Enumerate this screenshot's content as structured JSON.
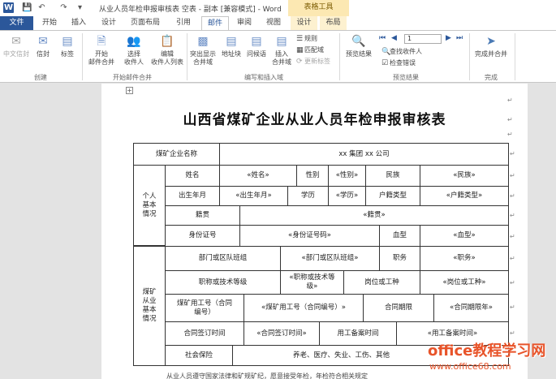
{
  "titlebar": {
    "title": "从业人员年检申报审核表 空表 - 副本 [兼容模式] - Word",
    "context_group": "表格工具",
    "app_icon": "W"
  },
  "tabs": {
    "file": "文件",
    "home": "开始",
    "insert": "插入",
    "design": "设计",
    "layout_page": "页面布局",
    "references": "引用",
    "mailings": "邮件",
    "review": "审阅",
    "view": "视图",
    "table_design": "设计",
    "table_layout": "布局"
  },
  "ribbon": {
    "create": {
      "chinese_envelope": "中文信封",
      "envelope": "信封",
      "labels": "标签",
      "group": "创建"
    },
    "start_merge": {
      "start": "开始",
      "start2": "邮件合并",
      "select": "选择",
      "select2": "收件人",
      "edit": "编辑",
      "edit2": "收件人列表",
      "group": "开始邮件合并"
    },
    "write_insert": {
      "highlight": "突出显示",
      "highlight2": "合并域",
      "address_block": "地址块",
      "greeting": "问候语",
      "insert_field": "插入",
      "insert_field2": "合并域",
      "rules": "规则",
      "match_fields": "匹配域",
      "update_labels": "更新标签",
      "group": "编写和插入域"
    },
    "preview": {
      "preview_results": "预览结果",
      "record": "1",
      "find_recipient": "查找收件人",
      "check_errors": "检查错误",
      "group": "预览结果"
    },
    "finish": {
      "finish_merge": "完成并合并",
      "group": "完成"
    }
  },
  "document": {
    "title": "山西省煤矿企业从业人员年检申报审核表",
    "company_label": "煤矿企业名称",
    "company_value": "xx 集团 xx 公司",
    "personal_section": "个人基本情况",
    "name_label": "姓名",
    "name_field": "«姓名»",
    "gender_label": "性别",
    "gender_field": "«性别»",
    "ethnicity_label": "民族",
    "ethnicity_field": "«民族»",
    "birth_label": "出生年月",
    "birth_field": "«出生年月»",
    "education_label": "学历",
    "education_field": "«学历»",
    "hukou_label": "户籍类型",
    "hukou_field": "«户籍类型»",
    "native_label": "籍贯",
    "native_field": "«籍贯»",
    "id_label": "身份证号",
    "id_field": "«身份证号码»",
    "blood_label": "血型",
    "blood_field": "«血型»",
    "employment_section": "煤矿从业基本情况",
    "dept_label": "部门或区队班组",
    "dept_field": "«部门或区队班组»",
    "position_label": "职务",
    "position_field": "«职务»",
    "title_label": "职称或技术等级",
    "title_field": "«职称或技术等级»",
    "post_label": "岗位或工种",
    "post_field": "«岗位或工种»",
    "empno_label": "煤矿用工号（合同编号）",
    "empno_field": "«煤矿用工号（合同编号）»",
    "contract_term_label": "合同期限",
    "contract_term_field": "«合同期限年»",
    "contract_date_label": "合同签订时间",
    "contract_date_field": "«合同签订时间»",
    "filing_label": "用工备案时间",
    "filing_field": "«用工备案时间»",
    "insurance_label": "社会保险",
    "insurance_value": "养老、医疗、失业、工伤、其他",
    "bottom_partial": "从业人员遵守国家法律和矿规矿纪，愿意接受年检，年检符合相关规定"
  },
  "watermark": {
    "site_name": "office教程学习网",
    "url": "www.office68.com"
  },
  "colors": {
    "word_blue": "#2b579a",
    "context_tab": "#fce8b2",
    "watermark": "#e8542a"
  }
}
